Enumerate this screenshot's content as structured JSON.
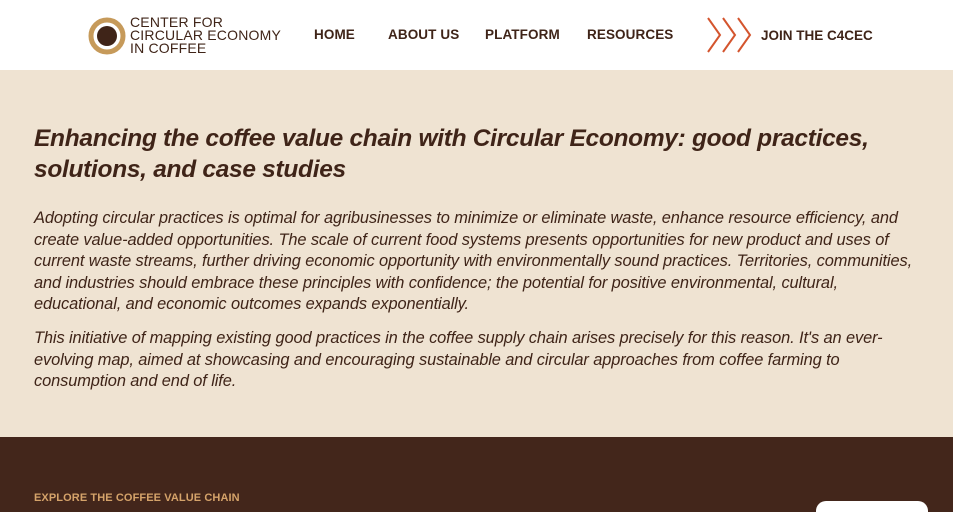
{
  "header": {
    "logo": {
      "lines": [
        "CENTER FOR",
        "CIRCULAR ECONOMY",
        "IN COFFEE"
      ]
    },
    "nav": [
      {
        "label": "HOME"
      },
      {
        "label": "ABOUT US"
      },
      {
        "label": "PLATFORM"
      },
      {
        "label": "RESOURCES"
      }
    ],
    "join_label": "JOIN THE C4CEC"
  },
  "hero": {
    "title": "Enhancing the coffee value chain with Circular Economy: good practices, solutions, and case studies",
    "paragraph1": "Adopting circular practices is optimal for agribusinesses to minimize or eliminate waste, enhance resource efficiency, and create value-added opportunities. The scale of current food systems presents opportunities for new product and uses of current waste streams, further driving economic opportunity with environmentally sound practices. Territories, communities, and industries should embrace these principles with confidence; the potential for positive environmental, cultural, educational, and economic outcomes expands exponentially.",
    "paragraph2": "This initiative of mapping existing good practices in the coffee supply chain arises precisely for this reason. It's an ever-evolving map, aimed at showcasing and encouraging sustainable and circular approaches from coffee farming to consumption and end of life."
  },
  "section": {
    "label": "EXPLORE THE COFFEE VALUE CHAIN"
  },
  "colors": {
    "brand_dark": "#3f2418",
    "accent_gold": "#c69a5a",
    "accent_orange": "#d4552e",
    "hero_bg": "#efe3d2",
    "band_bg": "#43261b",
    "band_label": "#d5a36a"
  },
  "icons": {
    "logo": "coffee-ring-logo-icon",
    "join": "triple-chevron-right-icon"
  }
}
